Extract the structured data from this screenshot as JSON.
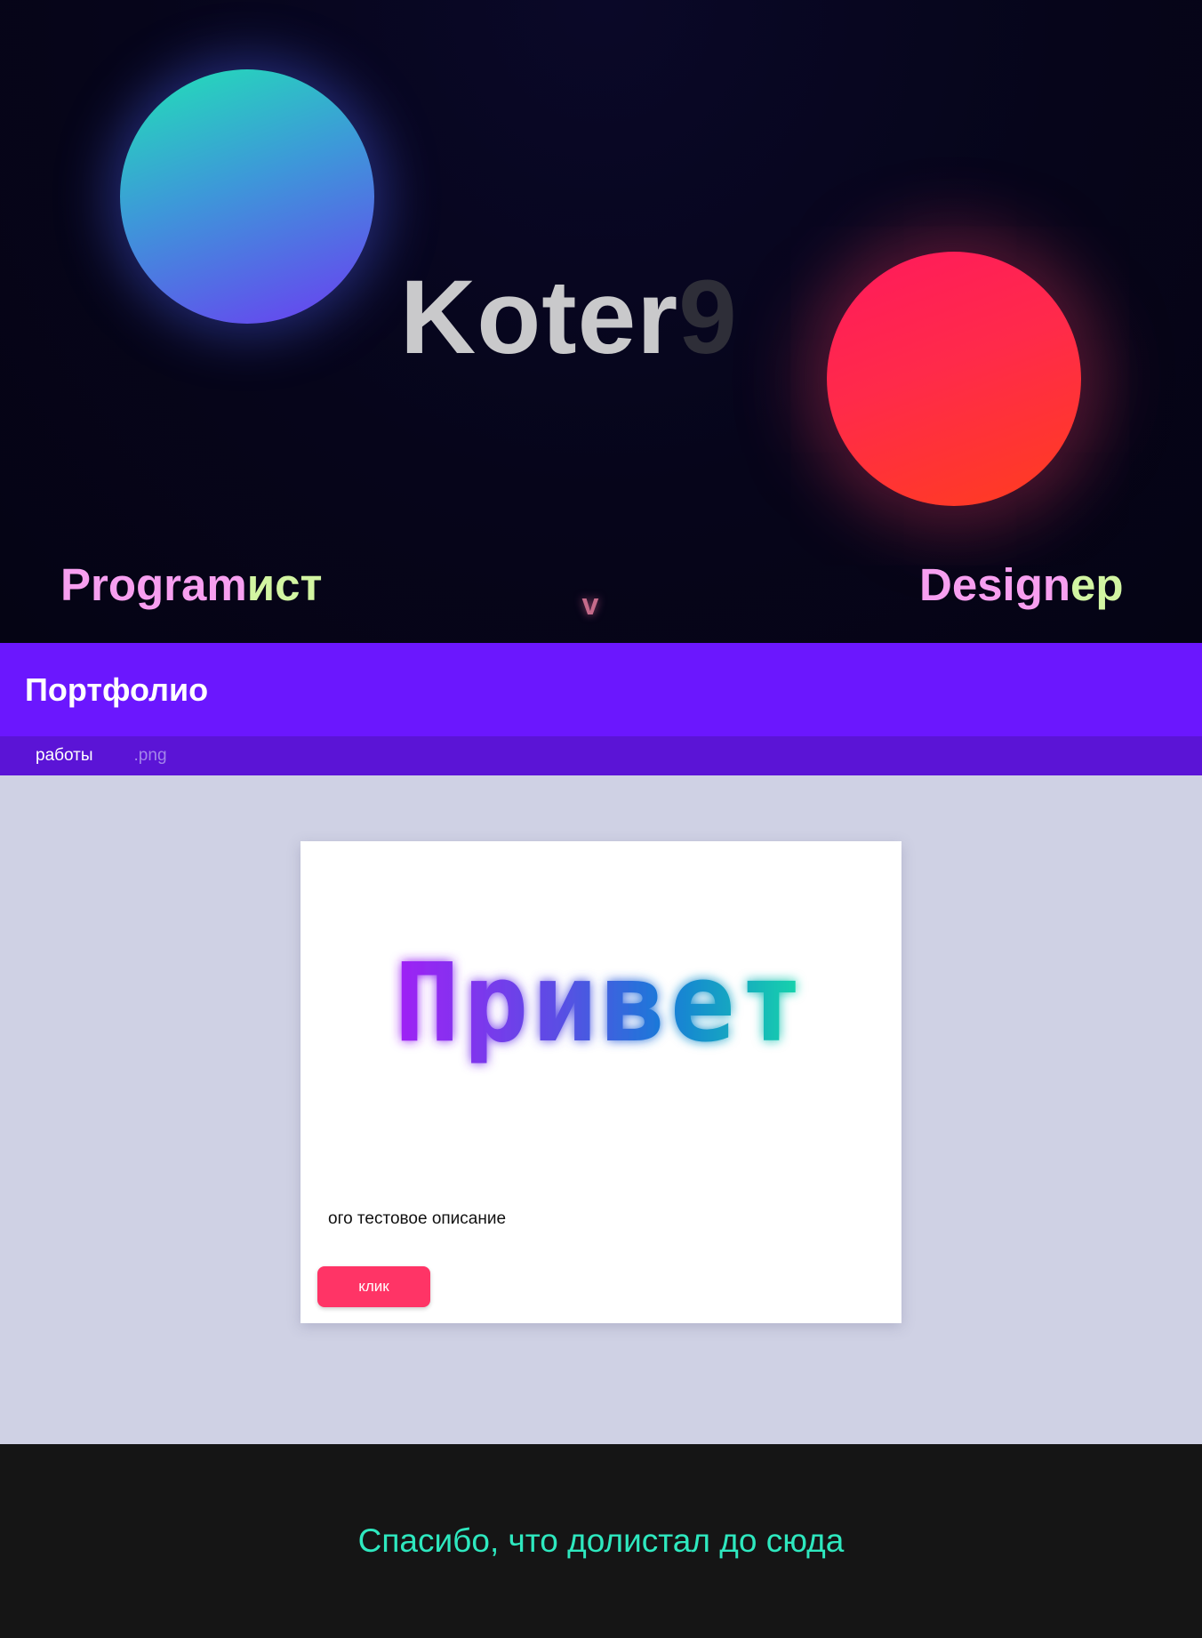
{
  "hero": {
    "title_main": "Koter",
    "title_dim": "9",
    "left_role": {
      "part1": "Program",
      "part2": "ист"
    },
    "right_role": {
      "part1": "Design",
      "part2": "ep"
    },
    "scroll_arrow": "v"
  },
  "header": {
    "title": "Портфолио"
  },
  "tabs": [
    {
      "label": "работы",
      "active": true
    },
    {
      "label": ".png",
      "active": false
    }
  ],
  "card": {
    "image_text": "Привет",
    "description": "ого тестовое описание",
    "button_label": "клик"
  },
  "footer": {
    "text": "Спасибо, что долистал до сюда"
  },
  "colors": {
    "header_bg": "#6b17fe",
    "tabs_bg": "#5b14d6",
    "main_bg": "#cfd1e4",
    "button_bg": "#ff3466",
    "footer_bg": "#151515",
    "footer_text": "#2ee8bf",
    "role_pink": "#f79ff0",
    "role_lime": "#d2f5a2"
  }
}
